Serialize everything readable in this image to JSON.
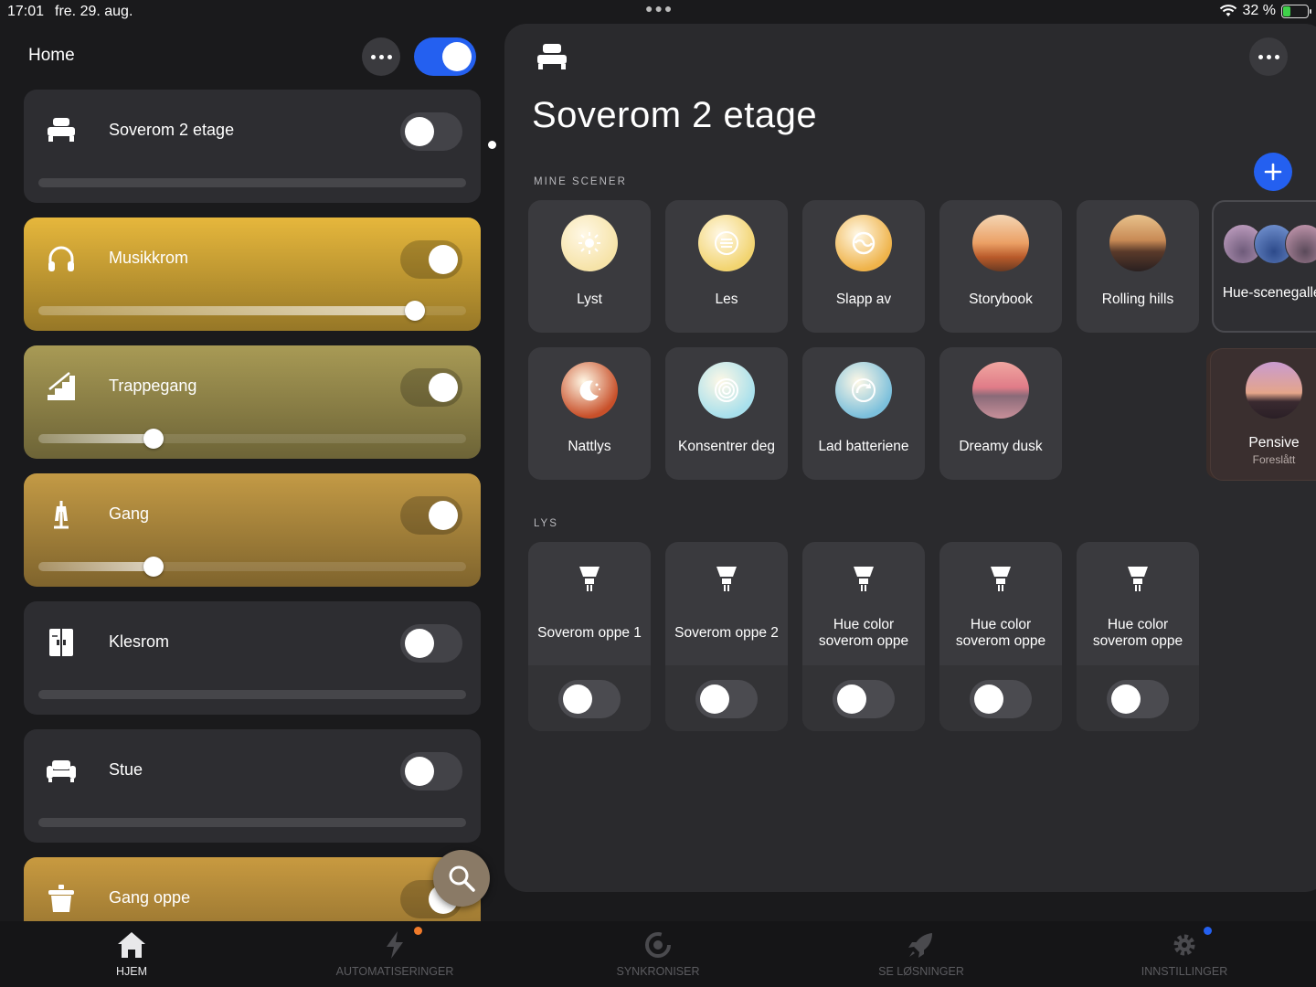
{
  "status": {
    "time": "17:01",
    "date": "fre. 29. aug.",
    "battery": "32 %",
    "battery_level": 0.32
  },
  "left": {
    "title": "Home",
    "rooms": [
      {
        "name": "Soverom 2 etage",
        "icon": "bed-icon",
        "on": false,
        "brightness": null
      },
      {
        "name": "Musikkrom",
        "icon": "headphones-icon",
        "on": true,
        "brightness": 0.88,
        "color": "#e6b73c"
      },
      {
        "name": "Trappegang",
        "icon": "stairs-icon",
        "on": true,
        "brightness": 0.27,
        "color": "#a89a55"
      },
      {
        "name": "Gang",
        "icon": "coat-rack-icon",
        "on": true,
        "brightness": 0.27,
        "color": "#c39a45"
      },
      {
        "name": "Klesrom",
        "icon": "wardrobe-icon",
        "on": false,
        "brightness": null
      },
      {
        "name": "Stue",
        "icon": "sofa-icon",
        "on": false,
        "brightness": null
      },
      {
        "name": "Gang oppe",
        "icon": "lamp-icon",
        "on": true,
        "brightness": null,
        "color": "#c89a40"
      }
    ]
  },
  "panel": {
    "title": "Soverom 2 etage",
    "scenes_label": "MINE SCENER",
    "lights_label": "LYS",
    "scenes": [
      {
        "name": "Lyst",
        "icon": "sun-icon",
        "color": "#f6e3a8"
      },
      {
        "name": "Les",
        "icon": "read-icon",
        "color": "#f2d470"
      },
      {
        "name": "Slapp av",
        "icon": "relax-icon",
        "color": "#efb34a"
      },
      {
        "name": "Storybook",
        "icon": "storybook-image",
        "color": "#d9833c"
      },
      {
        "name": "Rolling hills",
        "icon": "rolling-hills-image",
        "color": "#9a6a3e"
      },
      {
        "name": "Nattlys",
        "icon": "moon-icon",
        "color": "#c8502a"
      },
      {
        "name": "Konsentrer deg",
        "icon": "concentrate-icon",
        "color": "#a8e0ec"
      },
      {
        "name": "Lad batteriene",
        "icon": "recharge-icon",
        "color": "#7cc0dc"
      },
      {
        "name": "Dreamy dusk",
        "icon": "dreamy-dusk-image",
        "color": "#d88a8e"
      }
    ],
    "gallery": {
      "name": "Hue-scenegalleri"
    },
    "suggested": {
      "name": "Pensive",
      "sub": "Foreslått"
    },
    "lights": [
      {
        "name": "Soverom oppe 1",
        "on": false
      },
      {
        "name": "Soverom oppe 2",
        "on": false
      },
      {
        "name": "Hue color soverom oppe",
        "on": false
      },
      {
        "name": "Hue color soverom oppe",
        "on": false
      },
      {
        "name": "Hue color soverom oppe",
        "on": false
      }
    ]
  },
  "tabs": [
    {
      "label": "HJEM",
      "icon": "home-icon",
      "active": true
    },
    {
      "label": "AUTOMATISERINGER",
      "icon": "automation-icon",
      "active": false,
      "badge": "#f07a2a"
    },
    {
      "label": "SYNKRONISER",
      "icon": "sync-icon",
      "active": false
    },
    {
      "label": "SE LØSNINGER",
      "icon": "rocket-icon",
      "active": false
    },
    {
      "label": "INNSTILLINGER",
      "icon": "settings-icon",
      "active": false,
      "badge": "#2460f0"
    }
  ],
  "colors": {
    "accent": "#2460f0",
    "background": "#1a1a1c",
    "panel": "#2a2a2d"
  }
}
